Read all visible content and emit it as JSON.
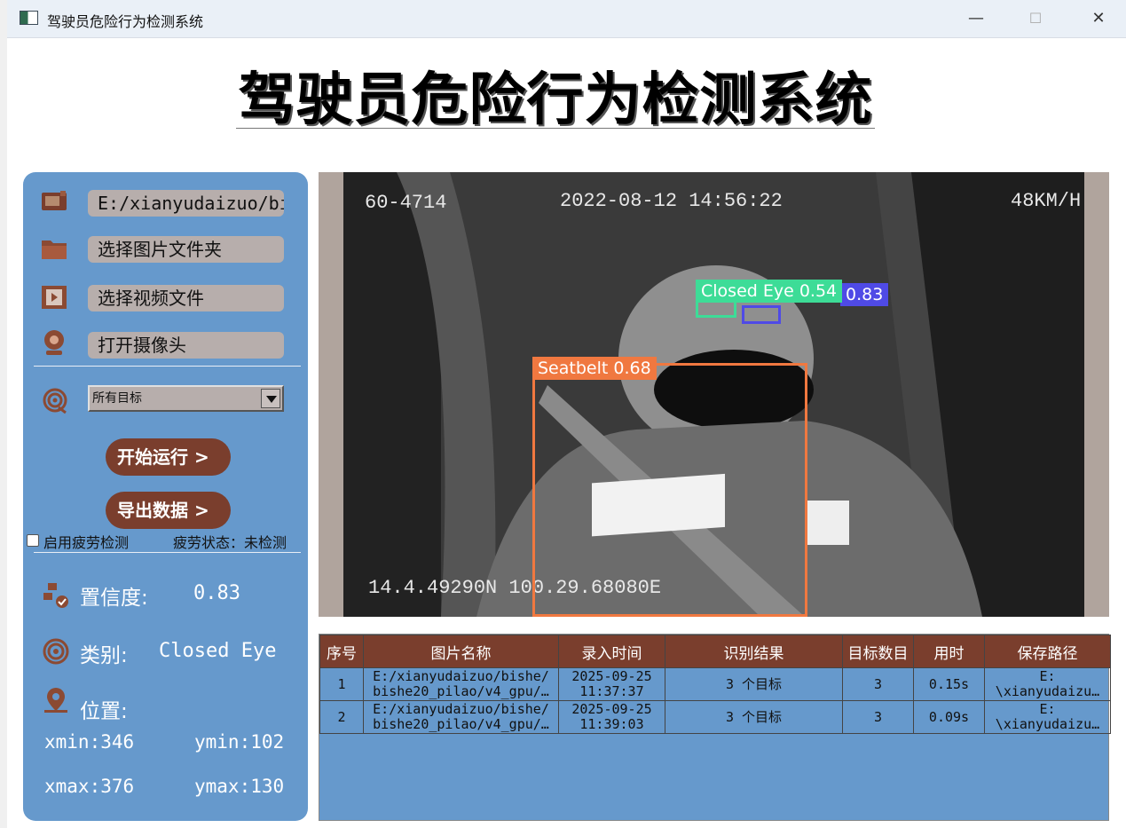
{
  "window": {
    "title": "驾驶员危险行为检测系统",
    "controls": [
      "minimize",
      "maximize",
      "close"
    ]
  },
  "header": {
    "title": "驾驶员危险行为检测系统"
  },
  "sidebar": {
    "file_path": "E:/xianyudaizuo/bis",
    "folder_btn": "选择图片文件夹",
    "video_btn": "选择视频文件",
    "camera_btn": "打开摄像头",
    "target_select": "所有目标",
    "run_btn": "开始运行 >",
    "export_btn": "导出数据 >",
    "fatigue_label": "启用疲劳检测",
    "fatigue_checked": false,
    "fatigue_status": "疲劳状态：未检测",
    "confidence_label": "置信度:",
    "confidence_value": "0.83",
    "class_label": "类别:",
    "class_value": "Closed Eye",
    "position_label": "位置:",
    "xmin": "xmin:346",
    "ymin": "ymin:102",
    "xmax": "xmax:376",
    "ymax": "ymax:130",
    "icons": [
      "image-file-icon",
      "folder-icon",
      "video-icon",
      "camera-icon",
      "target-icon",
      "confidence-icon",
      "class-icon",
      "location-icon"
    ]
  },
  "image": {
    "plate": "60-4714",
    "timestamp": "2022-08-12 14:56:22",
    "speed": "48KM/H",
    "gps": "14.4.49290N 100.29.68080E",
    "detections": [
      {
        "label": "Closed Eye 0.54",
        "color": "#3ddc97"
      },
      {
        "label": "0.83",
        "color": "#4f4ae6"
      },
      {
        "label": "Seatbelt 0.68",
        "color": "#f07840"
      }
    ]
  },
  "table": {
    "headers": [
      "序号",
      "图片名称",
      "录入时间",
      "识别结果",
      "目标数目",
      "用时",
      "保存路径"
    ],
    "rows": [
      {
        "index": "1",
        "name1": "E:/xianyudaizuo/bishe/",
        "name2": "bishe20_pilao/v4_gpu/…",
        "time1": "2025-09-25",
        "time2": "11:37:37",
        "result": "3 个目标",
        "count": "3",
        "duration": "0.15s",
        "path1": "E:",
        "path2": "\\xianyudaizu…"
      },
      {
        "index": "2",
        "name1": "E:/xianyudaizuo/bishe/",
        "name2": "bishe20_pilao/v4_gpu/…",
        "time1": "2025-09-25",
        "time2": "11:39:03",
        "result": "3 个目标",
        "count": "3",
        "duration": "0.09s",
        "path1": "E:",
        "path2": "\\xianyudaizu…"
      }
    ]
  },
  "colors": {
    "panel": "#6699cc",
    "accent": "#7a3e2d",
    "button": "#b7aeac"
  }
}
